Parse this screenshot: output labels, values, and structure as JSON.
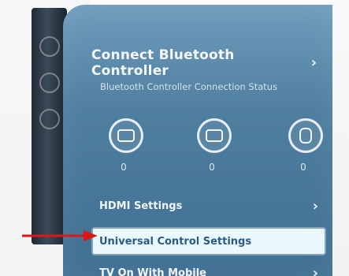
{
  "menu": {
    "title": "Connect Bluetooth Controller",
    "subtitle": "Bluetooth Controller Connection Status",
    "devices": [
      {
        "icon": "gamepad-icon",
        "count": "0"
      },
      {
        "icon": "keyboard-icon",
        "count": "0"
      },
      {
        "icon": "mouse-icon",
        "count": "0"
      }
    ],
    "items": [
      {
        "label": "HDMI Settings",
        "selected": false
      },
      {
        "label": "Universal Control Settings",
        "selected": true
      },
      {
        "label": "TV On With Mobile",
        "selected": false
      }
    ]
  },
  "colors": {
    "panel": "#4f7e9f",
    "selected_bg": "#e9f7ff",
    "arrow": "#e01616"
  }
}
